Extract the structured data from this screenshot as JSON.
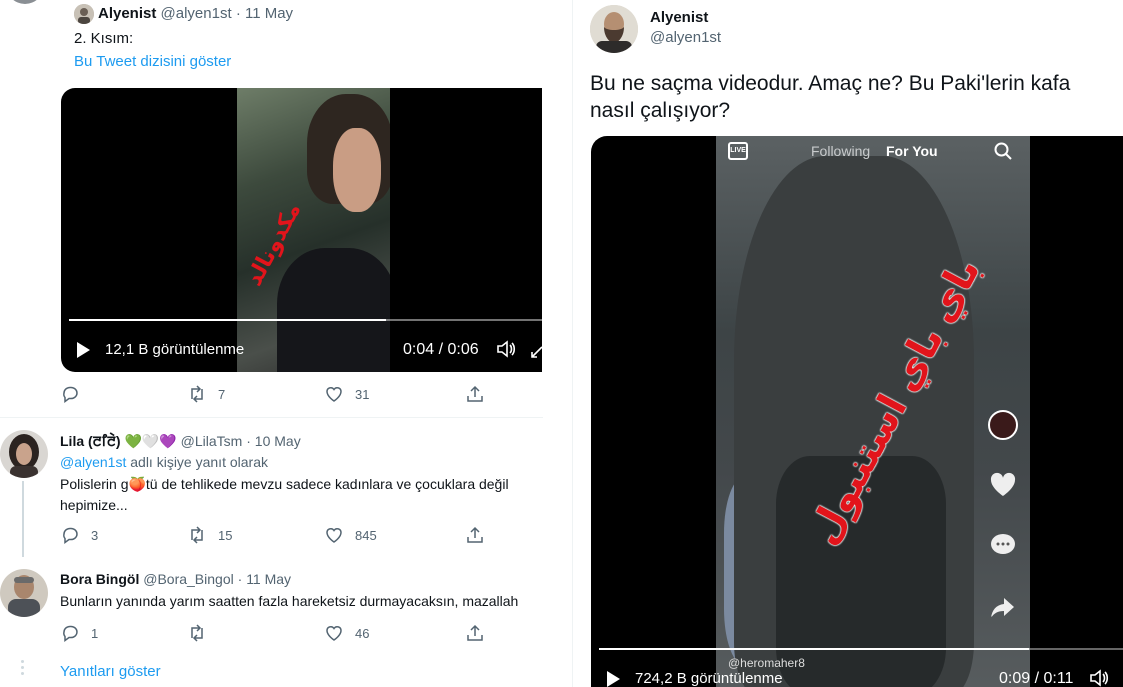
{
  "tweet_main_left": {
    "name": "Alyenist",
    "handle": "@alyen1st",
    "date": "11 May",
    "text": "2. Kısım:",
    "show_thread": "Bu Tweet dizisini göster",
    "video": {
      "views": "12,1 B görüntülenme",
      "time": "0:04 / 0:06",
      "progress": 0.67
    },
    "actions": {
      "reply": "",
      "retweet": "7",
      "like": "31"
    }
  },
  "replies": [
    {
      "name": "Lila (ꯂꯤꯂꯥ)",
      "emojis": "💚🤍💜",
      "handle": "@LilaTsm",
      "date": "10 May",
      "reply_prefix": "@alyen1st",
      "reply_suffix": "adlı kişiye yanıt olarak",
      "text_line1": "Polislerin g🍑tü de tehlikede  mevzu sadece kadınlara ve çocuklara değil",
      "text_line2": "hepimize...",
      "actions": {
        "reply": "3",
        "retweet": "15",
        "like": "845"
      }
    },
    {
      "name": "Bora Bingöl",
      "handle": "@Bora_Bingol",
      "date": "11 May",
      "text_line1": "Bunların yanında yarım saatten fazla hareketsiz durmayacaksın, mazallah",
      "actions": {
        "reply": "1",
        "retweet": "",
        "like": "46"
      }
    }
  ],
  "show_replies": "Yanıtları göster",
  "tweet_detail": {
    "name": "Alyenist",
    "handle": "@alyen1st",
    "text": "Bu ne saçma videodur. Amaç ne? Bu Paki'lerin kafa nasıl çalışıyor?",
    "video": {
      "top_live": "LIVE",
      "top_following": "Following",
      "top_foryou": "For You",
      "tiktok_handle": "@heromaher8",
      "views": "724,2 B görüntülenme",
      "time": "0:09 / 0:11",
      "progress": 0.82
    }
  },
  "overlay_text": {
    "video1_arabic": "مكدونالد",
    "video2_arabic": "باي باي استنبول"
  },
  "colors": {
    "link": "#1d9bf0",
    "muted": "#536471",
    "arabic_red": "#e2141b",
    "divider": "#eff3f4"
  }
}
